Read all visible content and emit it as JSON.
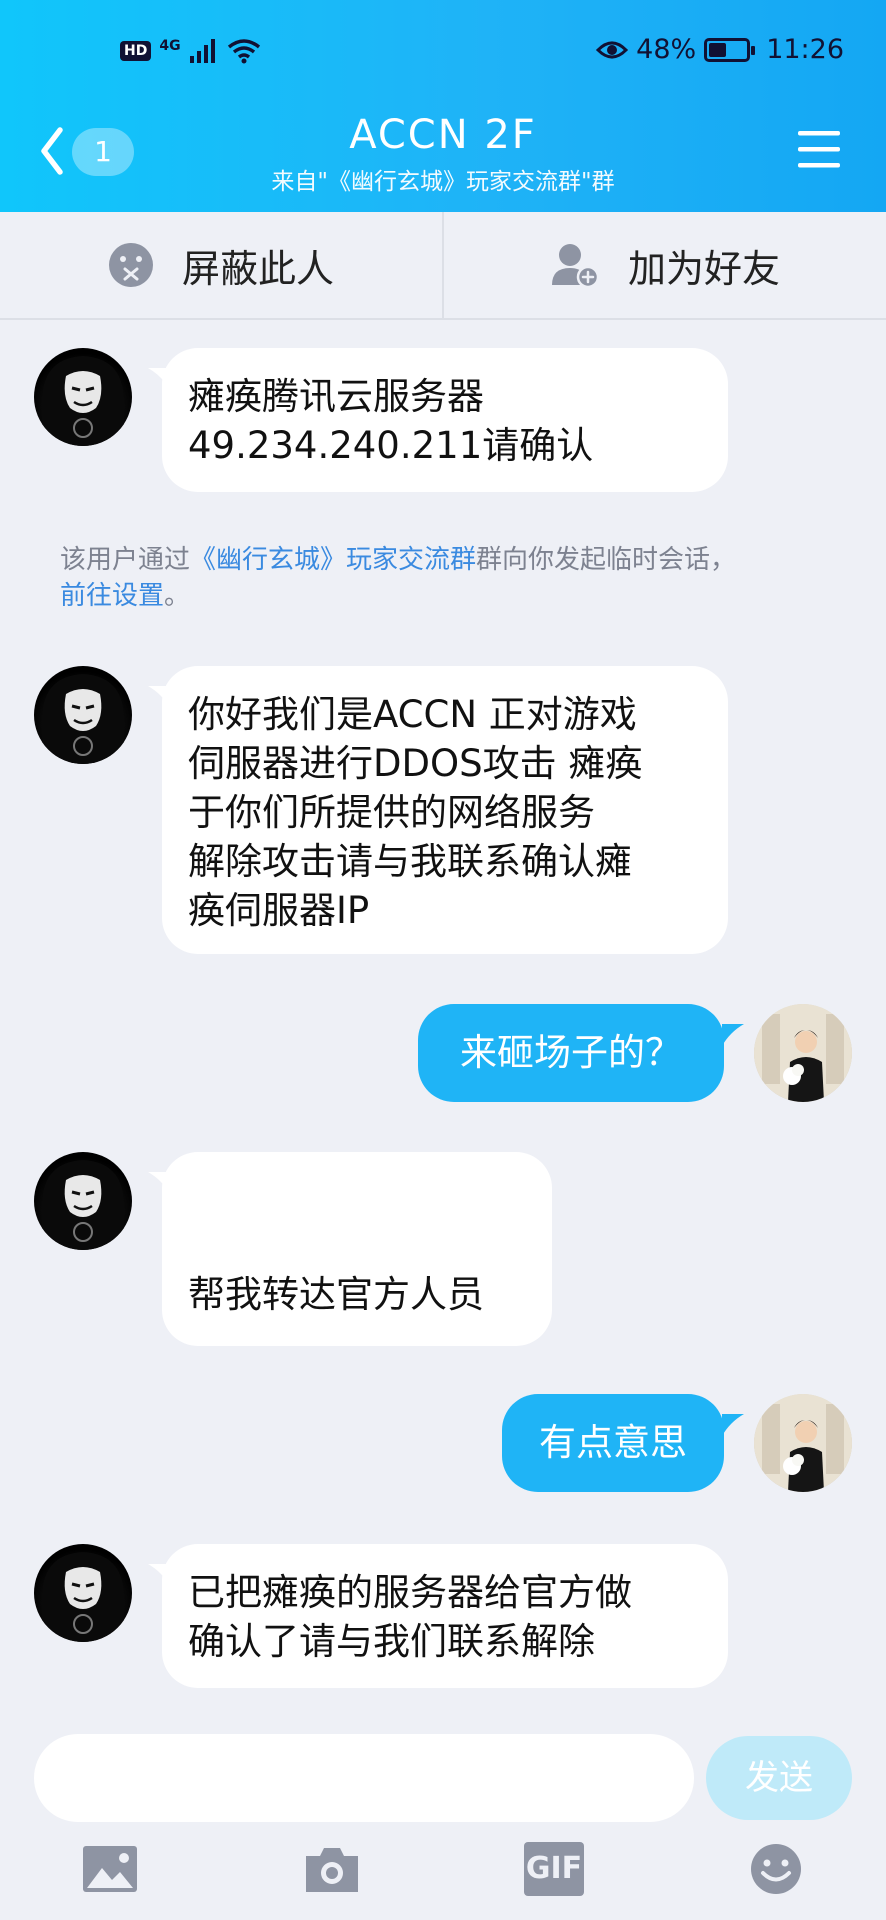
{
  "status": {
    "hd": "HD",
    "network": "4G",
    "battery": "48%",
    "battery_level": 0.48,
    "time": "11:26"
  },
  "header": {
    "unread_count": "1",
    "title": "ACCN  2F",
    "subtitle": "来自\"《幽行玄城》玩家交流群\"群"
  },
  "actions": {
    "block_label": "屏蔽此人",
    "add_friend_label": "加为好友"
  },
  "messages": [
    {
      "text": "瘫痪腾讯云服务器\n49.234.240.211请确认"
    },
    {
      "text": "你好我们是ACCN 正对游戏\n伺服器进行DDOS攻击 瘫痪\n于你们所提供的网络服务\n解除攻击请与我联系确认瘫\n痪伺服器IP"
    },
    {
      "text": "来砸场子的？"
    },
    {
      "text": "帮我转达官方人员"
    },
    {
      "text": "有点意思"
    },
    {
      "text": "已把瘫痪的服务器给官方做\n确认了请与我们联系解除"
    }
  ],
  "system_note": {
    "prefix": "该用户通过",
    "group_link": "《幽行玄城》玩家交流群",
    "middle": "群向你发起临时会话，",
    "settings_link": "前往设置",
    "suffix": "。"
  },
  "input": {
    "placeholder": "",
    "send_label": "发送"
  },
  "toolbar": {
    "gif_label": "GIF"
  }
}
